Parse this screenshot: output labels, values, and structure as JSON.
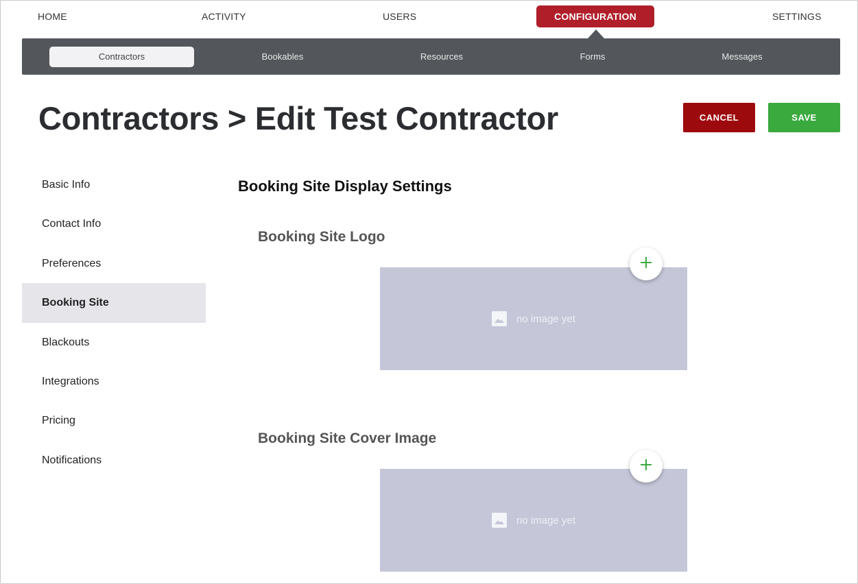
{
  "top_nav": {
    "home": "HOME",
    "activity": "ACTIVITY",
    "users": "USERS",
    "configuration": "CONFIGURATION",
    "settings": "SETTINGS",
    "active": "configuration"
  },
  "sub_nav": {
    "items": [
      "Contractors",
      "Bookables",
      "Resources",
      "Forms",
      "Messages"
    ],
    "active": "Contractors"
  },
  "header": {
    "title": "Contractors > Edit Test Contractor",
    "cancel_label": "CANCEL",
    "save_label": "SAVE"
  },
  "side_menu": {
    "items": [
      "Basic Info",
      "Contact Info",
      "Preferences",
      "Booking Site",
      "Blackouts",
      "Integrations",
      "Pricing",
      "Notifications"
    ],
    "active": "Booking Site"
  },
  "content": {
    "section_title": "Booking Site Display Settings",
    "logo": {
      "heading": "Booking Site Logo",
      "placeholder": "no image yet",
      "add_icon": "plus-icon"
    },
    "cover": {
      "heading": "Booking Site Cover Image",
      "placeholder": "no image yet",
      "add_icon": "plus-icon"
    }
  },
  "colors": {
    "accent_red": "#b01e2a",
    "cancel_red": "#9d0a0e",
    "save_green": "#3aaa3f",
    "subnav_gray": "#53575b",
    "placeholder_fill": "#c5c6d8"
  }
}
